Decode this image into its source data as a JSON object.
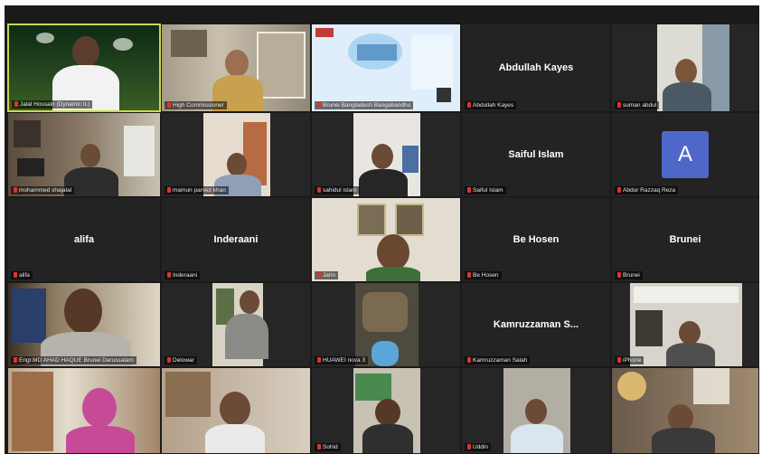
{
  "participants": [
    {
      "name": "Jalal Hossain (Dynamic IL)",
      "video": true,
      "active": true
    },
    {
      "name": "High Commissioner",
      "video": true
    },
    {
      "name": "Brunei Bangladesh Bangabandhu",
      "video": true
    },
    {
      "name": "Abdullah Kayes",
      "video": false,
      "display": "Abdullah Kayes"
    },
    {
      "name": "suman abdul",
      "video": true
    },
    {
      "name": "mohammed shajalal",
      "video": true
    },
    {
      "name": "mamun parvez khan",
      "video": true
    },
    {
      "name": "sahidul islam",
      "video": true
    },
    {
      "name": "Saiful Islam",
      "video": false,
      "display": "Saiful Islam"
    },
    {
      "name": "Abdur Razzaq Reza",
      "video": false,
      "avatar": "A"
    },
    {
      "name": "alifa",
      "video": false,
      "display": "alifa"
    },
    {
      "name": "Inderaani",
      "video": false,
      "display": "Inderaani"
    },
    {
      "name": "Jarin",
      "video": true
    },
    {
      "name": "Be Hosen",
      "video": false,
      "display": "Be Hosen"
    },
    {
      "name": "Brunei",
      "video": false,
      "display": "Brunei"
    },
    {
      "name": "Engr.MD AHAD HAQUE Brunei Darussalam",
      "video": true
    },
    {
      "name": "Delowar",
      "video": true
    },
    {
      "name": "HUAWEI nova 3",
      "video": true
    },
    {
      "name": "Kamruzzaman Salah",
      "video": false,
      "display": "Kamruzzaman S..."
    },
    {
      "name": "iPhone",
      "video": true
    },
    {
      "name": "",
      "video": true
    },
    {
      "name": "",
      "video": true
    },
    {
      "name": "Sohid",
      "video": true
    },
    {
      "name": "Uddin",
      "video": true
    },
    {
      "name": "",
      "video": true
    }
  ]
}
